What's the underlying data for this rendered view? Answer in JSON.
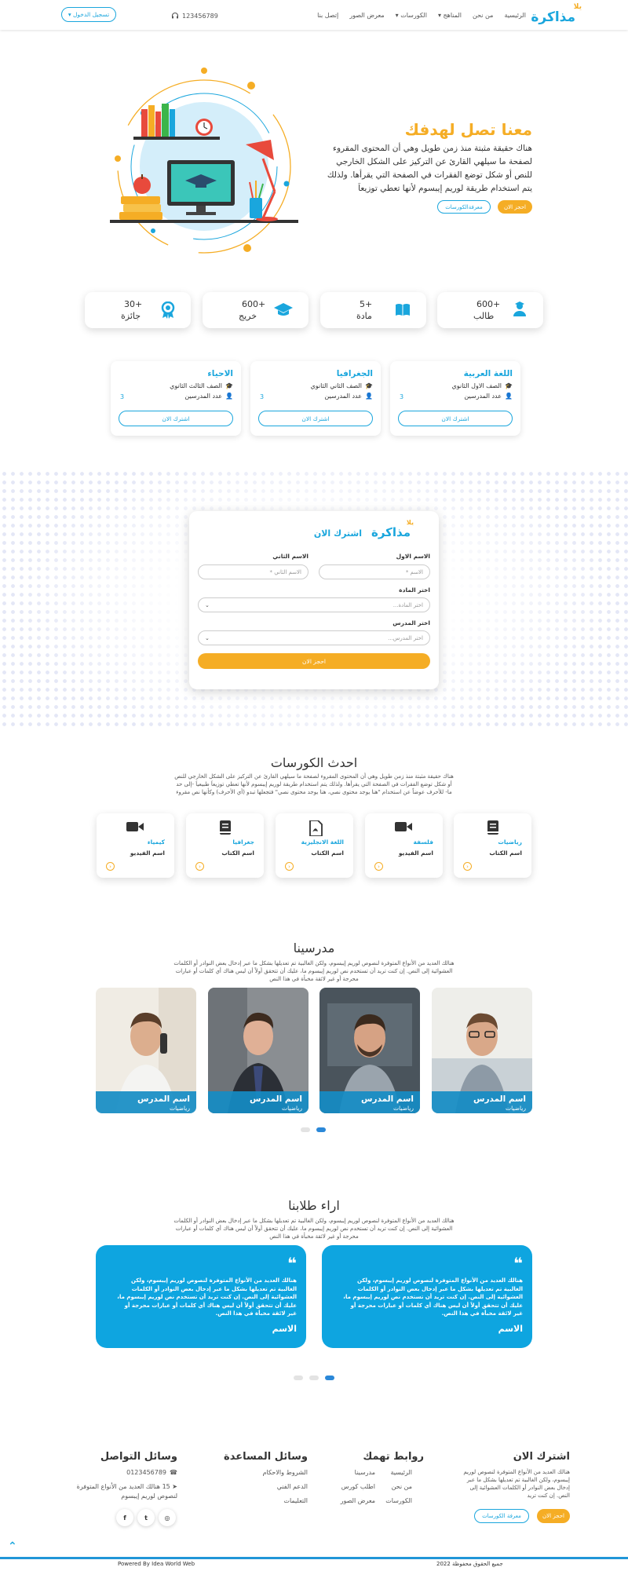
{
  "header": {
    "logo_top": "يلا",
    "logo_main": "مذاكرة",
    "nav": [
      "الرئيسية",
      "من نحن",
      "المناهج",
      "الكورسات",
      "معرض الصور",
      "إتصل بنا"
    ],
    "phone": "123456789",
    "login": "تسجيل الدخول"
  },
  "hero": {
    "title": "معنا تصل لهدفك",
    "text": "هناك حقيقة مثبتة منذ زمن طويل وهي أن المحتوى المقروء لصفحة ما سيلهي القارئ عن التركيز على الشكل الخارجي للنص أو شكل توضع الفقرات في الصفحة التي يقرأها. ولذلك يتم استخدام طريقة لوريم إيبسوم لأنها تعطي توزيعاَ",
    "btn_primary": "احجز الان",
    "btn_secondary": "معرفةالكورسات"
  },
  "stats": [
    {
      "num": "600",
      "plus": "+",
      "label": "طالب",
      "icon": "graduate-icon"
    },
    {
      "num": "5",
      "plus": "+",
      "label": "مادة",
      "icon": "book-icon"
    },
    {
      "num": "600",
      "plus": "+",
      "label": "خريج",
      "icon": "graduation-cap-icon"
    },
    {
      "num": "30",
      "plus": "+",
      "label": "جائزة",
      "icon": "award-icon"
    }
  ],
  "subjects": [
    {
      "title": "اللغة العربية",
      "grade": "الصف الاول الثانوي",
      "teachers_label": "عدد المدرسين",
      "teachers_count": "3",
      "button": "اشترك الان"
    },
    {
      "title": "الجغرافيا",
      "grade": "الصف الثاني الثانوي",
      "teachers_label": "عدد المدرسين",
      "teachers_count": "3",
      "button": "اشترك الان"
    },
    {
      "title": "الاحياء",
      "grade": "الصف الثالث الثانوي",
      "teachers_label": "عدد المدرسين",
      "teachers_count": "3",
      "button": "اشترك الان"
    }
  ],
  "signup_form": {
    "title": "اشترك الان",
    "first_name_label": "الاسم الاول",
    "first_name_placeholder": "الاسم *",
    "last_name_label": "الاسم الثاني",
    "last_name_placeholder": "الاسم الثاني *",
    "subject_label": "اختر المادة",
    "subject_placeholder": "اختر المادة...",
    "teacher_label": "اختر المدرس",
    "teacher_placeholder": "اختر المدرس...",
    "submit": "احجز الان"
  },
  "latest_courses": {
    "title": "احدث الكورسات",
    "text": "هناك حقيقة مثبتة منذ زمن طويل وهي أن المحتوى المقروء لصفحة ما سيلهي القارئ عن التركيز على الشكل الخارجي للنص أو شكل توضع الفقرات في الصفحة التي يقرأها. ولذلك يتم استخدام طريقة لوريم إيبسوم لأنها تعطي توزيعاَ طبيعياَ -إلى حد ما- للأحرف عوضاً عن استخدام \"هنا يوجد محتوى نصي، هنا يوجد محتوى نصي\" فتجعلها تبدو (أي الأحرف) وكأنها نص مقروء",
    "items": [
      {
        "subject": "رياضيات",
        "name": "اسم الكتاب",
        "icon": "book-icon"
      },
      {
        "subject": "فلسفة",
        "name": "اسم الفيديو",
        "icon": "video-icon"
      },
      {
        "subject": "اللغة الانجليزية",
        "name": "اسم الكتاب",
        "icon": "pdf-icon"
      },
      {
        "subject": "جغرافيا",
        "name": "اسم الكتاب",
        "icon": "book-icon"
      },
      {
        "subject": "كيمياء",
        "name": "اسم الفيديو",
        "icon": "video-icon"
      }
    ]
  },
  "teachers": {
    "title": "مدرسينا",
    "text": "هنالك العديد من الأنواع المتوفرة لنصوص لوريم إيبسوم، ولكن الغالبية تم تعديلها بشكل ما عبر إدخال بعض النوادر أو الكلمات العشوائية إلى النص. إن كنت تريد أن تستخدم نص لوريم إيبسوم ما، عليك أن تتحقق أولاً أن ليس هناك أي كلمات أو عبارات محرجة أو غير لائقة مخبأة في هذا النص",
    "items": [
      {
        "name": "اسم المدرس",
        "subject": "رياضيات"
      },
      {
        "name": "اسم المدرس",
        "subject": "رياضيات"
      },
      {
        "name": "اسم المدرس",
        "subject": "رياضيات"
      },
      {
        "name": "اسم المدرس",
        "subject": "رياضيات"
      }
    ]
  },
  "reviews": {
    "title": "اراء طلابنا",
    "text": "هنالك العديد من الأنواع المتوفرة لنصوص لوريم إيبسوم، ولكن الغالبية تم تعديلها بشكل ما عبر إدخال بعض النوادر أو الكلمات العشوائية إلى النص. إن كنت تريد أن تستخدم نص لوريم إيبسوم ما، عليك أن تتحقق أولاً أن ليس هناك أي كلمات أو عبارات محرجة أو غير لائقة مخبأة في هذا النص",
    "items": [
      {
        "quote": "هنالك العديد من الأنواع المتوفرة لنصوص لوريم إيبسوم، ولكن الغالبية تم تعديلها بشكل ما عبر إدخال بعض النوادر أو الكلمات العشوائية إلى النص. إن كنت تريد أن تستخدم نص لوريم إيبسوم ما، عليك أن تتحقق أولاً أن ليس هناك أي كلمات أو عبارات محرجة أو غير لائقة مخبأة في هذا النص.",
        "name": "الاسم"
      },
      {
        "quote": "هنالك العديد من الأنواع المتوفرة لنصوص لوريم إيبسوم، ولكن الغالبية تم تعديلها بشكل ما عبر إدخال بعض النوادر أو الكلمات العشوائية إلى النص. إن كنت تريد أن تستخدم نص لوريم إيبسوم ما، عليك أن تتحقق أولاً أن ليس هناك أي كلمات أو عبارات محرجة أو غير لائقة مخبأة في هذا النص.",
        "name": "الاسم"
      }
    ]
  },
  "footer": {
    "subscribe_title": "اشترك الان",
    "subscribe_text": "هنالك العديد من الأنواع المتوفرة لنصوص لوريم إيبسوم، ولكن الغالبية تم تعديلها بشكل ما عبر إدخال بعض النوادر أو الكلمات العشوائية إلى النص. إن كنت تريد",
    "subscribe_btn": "احجز الان",
    "courses_btn": "معرفة الكورسات",
    "links_title": "روابط تهمك",
    "links_col1": [
      "الرئيسية",
      "من نحن",
      "الكورسات"
    ],
    "links_col2": [
      "مدرسينا",
      "اطلب كورس",
      "معرض الصور"
    ],
    "help_title": "وسائل المساعدة",
    "help_links": [
      "الشروط والاحكام",
      "الدعم الفني",
      "التعليمات"
    ],
    "contact_title": "وسائل التواصل",
    "contact_phone": "0123456789",
    "contact_address": "15 هنالك العديد من الأنواع المتوفرة لنصوص لوريم إيبسوم",
    "socials": [
      "instagram",
      "twitter",
      "facebook"
    ],
    "copyright": "جميع الحقوق محفوظة 2022",
    "powered": "Powered By",
    "powered_name": "Idea World Web"
  },
  "colors": {
    "primary": "#1aa6dd",
    "accent": "#f5ad25",
    "review_bg": "#0ea5e0"
  }
}
